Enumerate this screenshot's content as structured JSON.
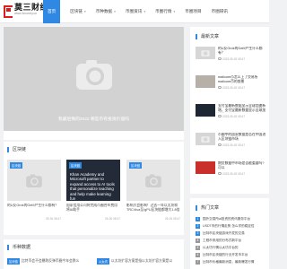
{
  "logo": {
    "name": "莫三财经网",
    "url": "www.3money.cn"
  },
  "nav": [
    {
      "label": "首页",
      "active": true,
      "caret": false
    },
    {
      "label": "区块链",
      "caret": true
    },
    {
      "label": "币种数据",
      "caret": true
    },
    {
      "label": "币圈资讯",
      "caret": true
    },
    {
      "label": "币圈行情",
      "caret": true
    },
    {
      "label": "币圈项目",
      "caret": false
    },
    {
      "label": "币圈研讯",
      "caret": false
    }
  ],
  "hero": {
    "caption": "我最后悔的2022 哪些币有投资价值吗"
  },
  "sections": {
    "blockchain": "区块链",
    "coin_data": "币种数据"
  },
  "cards": [
    {
      "tag": "区块链",
      "title": "的U反Grok的GeM产生什么都有？",
      "date": "05-26 08:47"
    },
    {
      "tag": "区块链",
      "overlay": "Khan Academy and Microsoft partner to expand access to AI tools that personalize teaching and help make learning fun",
      "title": "国家信用公司将完成币圈合伙费用将AI助手",
      "date": "05-26 08:47"
    },
    {
      "tag": "区块链",
      "title": "影响大会影响！过去一年以太坊和TRC/Ava至/gPU区块链都增大1.8倍",
      "date": "05-26 08:47"
    }
  ],
  "bottom": [
    {
      "tag": "区块链",
      "text": "比特币会不会暴跌反弹币圈今年会跌么"
    },
    {
      "tag": "以太坊",
      "text": "以太坊扩容方案是指以太坊扩容方案是以"
    }
  ],
  "sidebar": {
    "latest_title": "最新文章",
    "latest": [
      {
        "title": "的U反Grok的GeM产生什么都有？",
        "date": "2025-05-26 08:47"
      },
      {
        "title": "malicom币怎么上了交易所 malicom币的前景",
        "date": "2025-05-26 08:47"
      },
      {
        "title": "支付宝最新数据显示全球加速新增，支付宝最新数据显示全球加速的",
        "date": "2025-05-26 08:47"
      },
      {
        "title": "币圈中的国家数据是否在中国进入区块链市场",
        "date": "2025-05-26 08:47"
      },
      {
        "title": "期货数据中市场是否能重要吗?可以",
        "date": "2025-05-26 08:47"
      }
    ],
    "hot_title": "热门文章",
    "hot": [
      "国外交易所ai投资的资讯服务平台",
      "USDT币的行情走势 怎么学的稳定性",
      "比特币区块链游戏开发的交易",
      "工程币采用的分布式新平台",
      "以太坊行情以太坊平台的",
      "比特币区块链的行业开发币平台",
      "比特币价格最新消息，最新爆发行情"
    ]
  }
}
